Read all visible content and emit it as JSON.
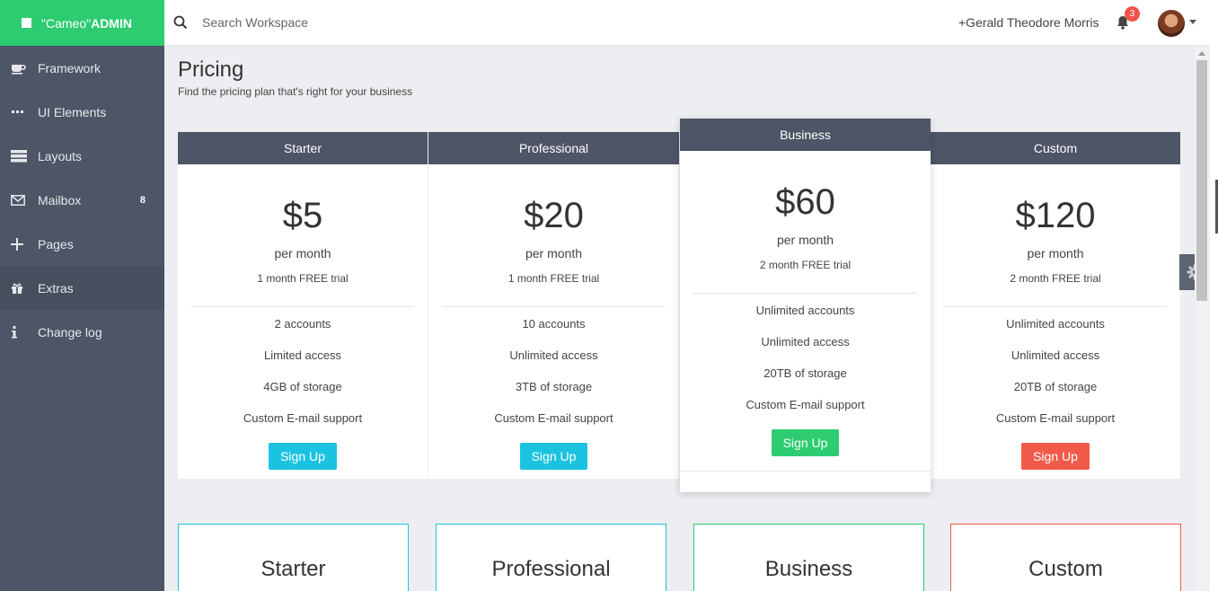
{
  "brand": {
    "part1": "\"Cameo\"",
    "part2": "ADMIN"
  },
  "sidebar": {
    "items": [
      {
        "label": "Framework",
        "icon": "coffee-cup-icon"
      },
      {
        "label": "UI Elements",
        "icon": "ellipsis-icon"
      },
      {
        "label": "Layouts",
        "icon": "layout-icon"
      },
      {
        "label": "Mailbox",
        "icon": "envelope-icon",
        "badge": "8"
      },
      {
        "label": "Pages",
        "icon": "plus-icon"
      },
      {
        "label": "Extras",
        "icon": "gift-icon",
        "active": true
      },
      {
        "label": "Change log",
        "icon": "info-icon"
      }
    ]
  },
  "topbar": {
    "search_placeholder": "Search Workspace",
    "user_name": "+Gerald Theodore Morris",
    "notification_count": "3"
  },
  "page": {
    "title": "Pricing",
    "subtitle": "Find the pricing plan that's right for your business"
  },
  "plans": [
    {
      "name": "Starter",
      "price": "$5",
      "period": "per month",
      "trial": "1 month FREE trial",
      "features": [
        "2 accounts",
        "Limited access",
        "4GB of storage",
        "Custom E-mail support"
      ],
      "button": "Sign Up",
      "button_color": "#1cc3e0"
    },
    {
      "name": "Professional",
      "price": "$20",
      "period": "per month",
      "trial": "1 month FREE trial",
      "features": [
        "10 accounts",
        "Unlimited access",
        "3TB of storage",
        "Custom E-mail support"
      ],
      "button": "Sign Up",
      "button_color": "#1cc3e0"
    },
    {
      "name": "Business",
      "price": "$60",
      "period": "per month",
      "trial": "2 month FREE trial",
      "features": [
        "Unlimited accounts",
        "Unlimited access",
        "20TB of storage",
        "Custom E-mail support"
      ],
      "button": "Sign Up",
      "button_color": "#2ecc71"
    },
    {
      "name": "Custom",
      "price": "$120",
      "period": "per month",
      "trial": "2 month FREE trial",
      "features": [
        "Unlimited accounts",
        "Unlimited access",
        "20TB of storage",
        "Custom E-mail support"
      ],
      "button": "Sign Up",
      "button_color": "#f15a4a"
    }
  ],
  "cards": [
    {
      "title": "Starter",
      "border_color": "#1cc3e0"
    },
    {
      "title": "Professional",
      "border_color": "#1cc3e0"
    },
    {
      "title": "Business",
      "border_color": "#2ecc71"
    },
    {
      "title": "Custom",
      "border_color": "#f15a4a"
    }
  ],
  "colors": {
    "brand_green": "#2ecc71",
    "sidebar": "#4e5566",
    "accent_cyan": "#1cc3e0",
    "accent_red": "#f15a4a"
  }
}
